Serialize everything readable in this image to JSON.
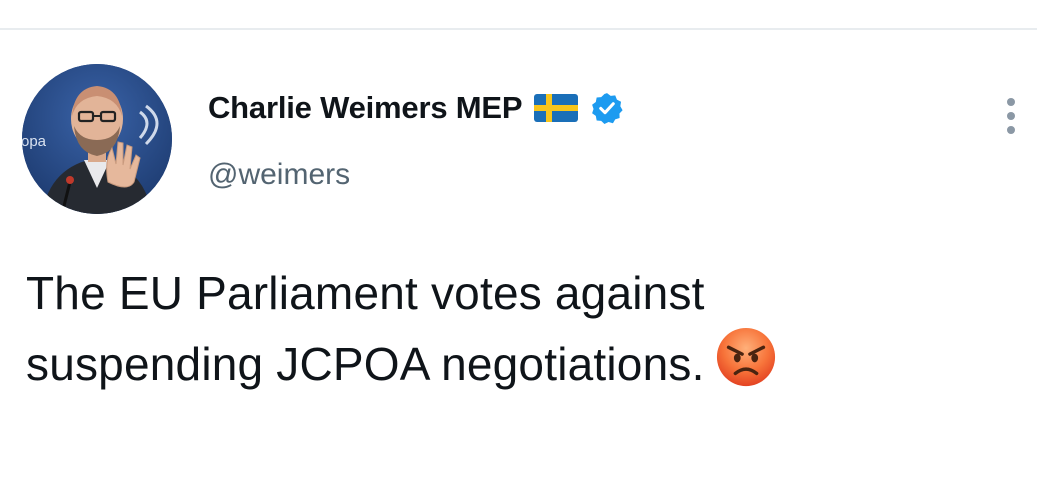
{
  "tweet": {
    "author": {
      "display_name": "Charlie Weimers MEP",
      "handle": "@weimers",
      "flag_icon": "sweden-flag-icon",
      "verified_icon": "verified-badge-icon",
      "avatar_background_text": "ropa"
    },
    "text_line_1": "The EU Parliament votes against",
    "text_line_2": "suspending JCPOA negotiations.",
    "emoji": "angry-face-emoji",
    "menu_icon": "more-options-icon"
  },
  "colors": {
    "text_primary": "#0f1419",
    "text_secondary": "#536471",
    "verified_blue": "#1d9bf0",
    "divider": "#e8ecef",
    "flag_blue": "#1a6fb8",
    "flag_yellow": "#f7c51b"
  }
}
